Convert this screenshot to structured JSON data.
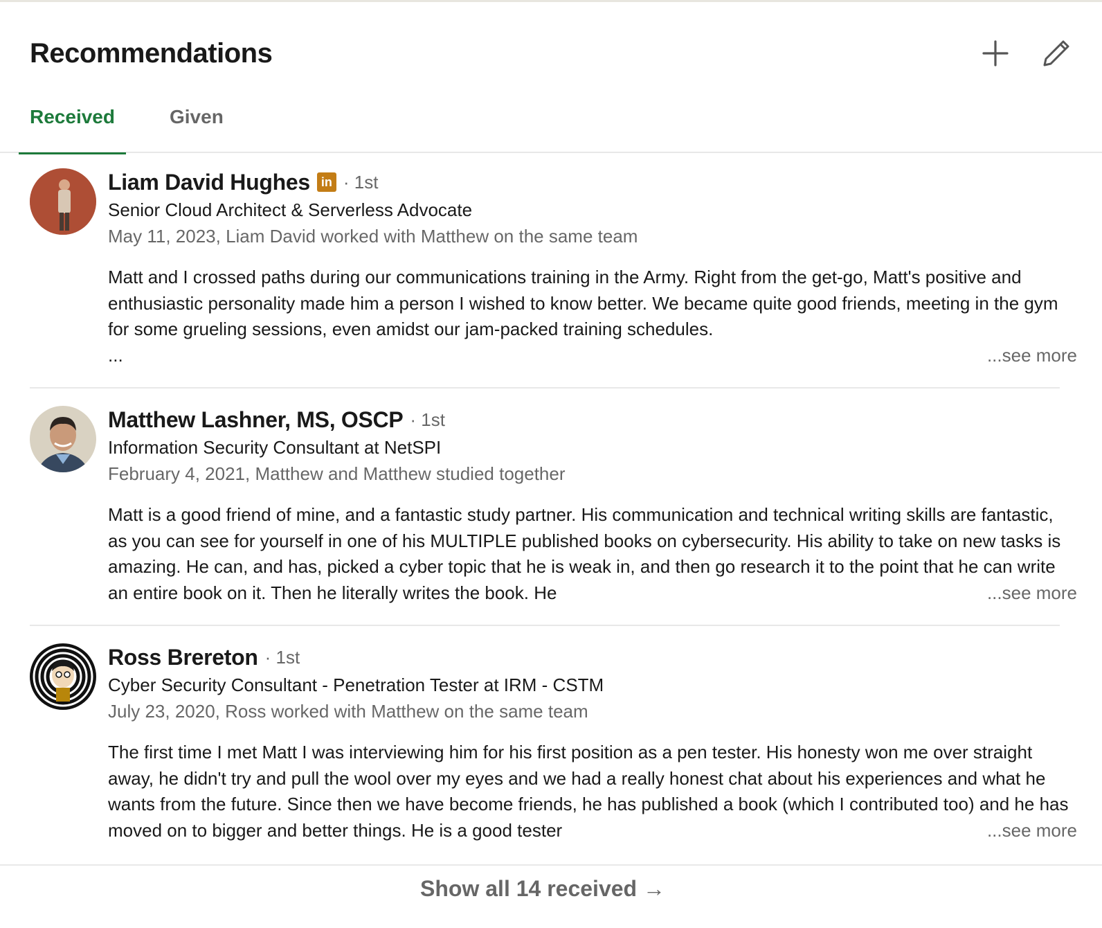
{
  "section": {
    "title": "Recommendations",
    "add_icon": "plus-icon",
    "edit_icon": "pencil-icon"
  },
  "tabs": [
    {
      "label": "Received",
      "active": true
    },
    {
      "label": "Given",
      "active": false
    }
  ],
  "colors": {
    "active_tab": "#1d7a3b",
    "linkedin_badge": "#c37d16"
  },
  "recommendations": [
    {
      "name": "Liam David Hughes",
      "has_linkedin_badge": true,
      "badge_text": "in",
      "degree": "· 1st",
      "headline": "Senior Cloud Architect & Serverless Advocate",
      "meta": "May 11, 2023, Liam David worked with Matthew on the same team",
      "text": "Matt and I crossed paths during our communications training in the Army. Right from the get-go, Matt's positive and enthusiastic personality made him a person I wished to know better. We became quite good friends, meeting in the gym for some grueling sessions, even amidst our jam-packed training schedules.",
      "trailing": "...",
      "see_more": "...see more"
    },
    {
      "name": "Matthew Lashner, MS, OSCP",
      "has_linkedin_badge": false,
      "degree": "· 1st",
      "headline": "Information Security Consultant at NetSPI",
      "meta": "February 4, 2021, Matthew and Matthew studied together",
      "text": "Matt is a good friend of mine, and a fantastic study partner. His communication and technical writing skills are fantastic, as you can see for yourself in one of his MULTIPLE published books on cybersecurity. His ability to take on new tasks is amazing. He can, and has, picked a cyber topic that he is weak in, and then go research it to the point that he can write an entire book on it. Then he literally writes the book. He",
      "see_more": "...see more"
    },
    {
      "name": "Ross Brereton",
      "has_linkedin_badge": false,
      "degree": "· 1st",
      "headline": "Cyber Security Consultant - Penetration Tester at IRM - CSTM",
      "meta": "July 23, 2020, Ross worked with Matthew on the same team",
      "text": "The first time I met Matt I was interviewing him for his first position as a pen tester. His honesty won me over straight away, he didn't try and pull the wool over my eyes and we had a really honest chat about his experiences and what he wants from the future. Since then we have become friends, he has published a book (which I contributed too) and he has moved on to bigger and better things. He is a good tester",
      "see_more": "...see more"
    }
  ],
  "footer": {
    "show_all": "Show all 14 received →"
  }
}
